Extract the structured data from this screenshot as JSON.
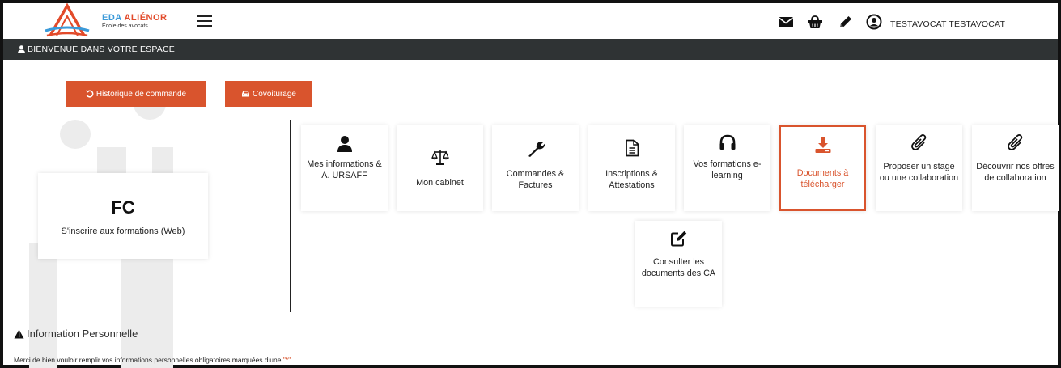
{
  "brand": {
    "name_part1": "EDA ",
    "name_part2": "ALIÉNOR",
    "tagline": "École des avocats"
  },
  "header": {
    "user_name": "TESTAVOCAT TESTAVOCAT"
  },
  "welcome_bar": {
    "label": "BIENVENUE DANS VOTRE ESPACE"
  },
  "actions": {
    "order_history": "Historique de commande",
    "carpool": "Covoiturage"
  },
  "fc_card": {
    "title": "FC",
    "subtitle": "S'inscrire aux formations (Web)"
  },
  "tiles": [
    {
      "label": "Mes informations & A. URSAFF",
      "icon": "user-icon"
    },
    {
      "label": "Mon cabinet",
      "icon": "balance-scale-icon"
    },
    {
      "label": "Commandes & Factures",
      "icon": "wrench-icon"
    },
    {
      "label": "Inscriptions & Attestations",
      "icon": "document-icon"
    },
    {
      "label": "Vos formations e-learning",
      "icon": "headphones-icon"
    },
    {
      "label": "Documents à télécharger",
      "icon": "download-icon",
      "active": true
    },
    {
      "label": "Proposer un stage ou une collaboration",
      "icon": "paperclip-icon"
    },
    {
      "label": "Découvrir nos offres de collaboration",
      "icon": "paperclip-icon"
    },
    {
      "label": "Consulter les documents des CA",
      "icon": "edit-icon"
    }
  ],
  "info": {
    "title": "Information Personnelle",
    "text": "Merci de bien vouloir remplir vos informations personnelles obligatoires marquées d'une ",
    "marker": "\"*\""
  },
  "colors": {
    "accent": "#d9542d",
    "dark_bar": "#2f3334",
    "brand_blue": "#3b9ad9"
  }
}
